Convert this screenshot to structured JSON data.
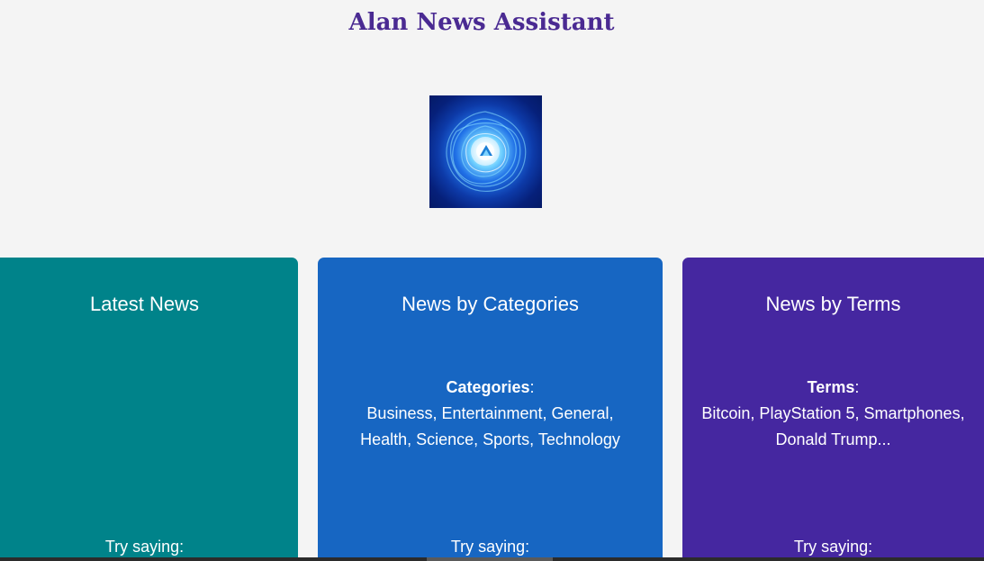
{
  "app": {
    "title": "Alan News Assistant"
  },
  "logo": {
    "icon": "alan-energy-orb-logo"
  },
  "cards": [
    {
      "title": "Latest News",
      "color": "#00838a",
      "body_label": "",
      "body_text": "",
      "try_label": "Try saying:"
    },
    {
      "title": "News by Categories",
      "color": "#1766c2",
      "body_label": "Categories",
      "body_line1": "Business, Entertainment, General,",
      "body_line2": "Health, Science, Sports, Technology",
      "try_label": "Try saying:"
    },
    {
      "title": "News by Terms",
      "color": "#4527a0",
      "body_label": "Terms",
      "body_line1": "Bitcoin, PlayStation 5, Smartphones,",
      "body_line2": "Donald Trump...",
      "try_label": "Try saying:"
    }
  ],
  "colors": {
    "background": "#f4f4f4",
    "title": "#4a2a92"
  }
}
